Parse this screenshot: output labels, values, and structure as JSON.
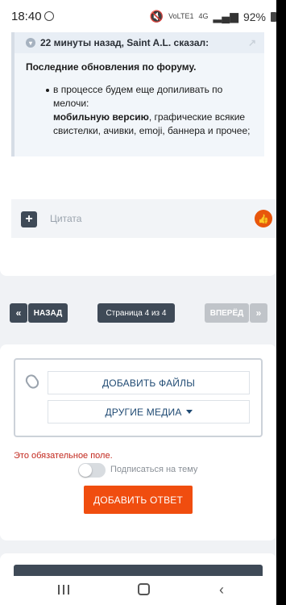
{
  "status_bar": {
    "time": "18:40",
    "volte_line1": "VoLTE1",
    "network": "4G",
    "battery": "92%"
  },
  "post": {
    "quote_header": "22 минуты назад, Saint A.L. сказал:",
    "quote_title": "Последние обновления по форуму.",
    "quote_item_prefix": "в процессе будем еще допиливать по мелочи:",
    "quote_item_bold": "мобильную версию",
    "quote_item_rest": ", графические всякие свистелки, ачивки, emoji, баннера и прочее;"
  },
  "reply": {
    "placeholder": "Цитата"
  },
  "pager": {
    "first": "«",
    "prev": "НАЗАД",
    "current": "Страница 4 из 4",
    "next": "ВПЕРЁД",
    "last": "»"
  },
  "form": {
    "add_files": "ДОБАВИТЬ ФАЙЛЫ",
    "other_media": "ДРУГИЕ МЕДИА",
    "error": "Это обязательное поле.",
    "subscribe_label": "Подписаться на тему",
    "subscribe_on": false,
    "submit": "ДОБАВИТЬ ОТВЕТ"
  },
  "colors": {
    "accent": "#f04d0f",
    "dark": "#3f4a57",
    "error": "#c2271d",
    "link": "#1f4a73"
  }
}
